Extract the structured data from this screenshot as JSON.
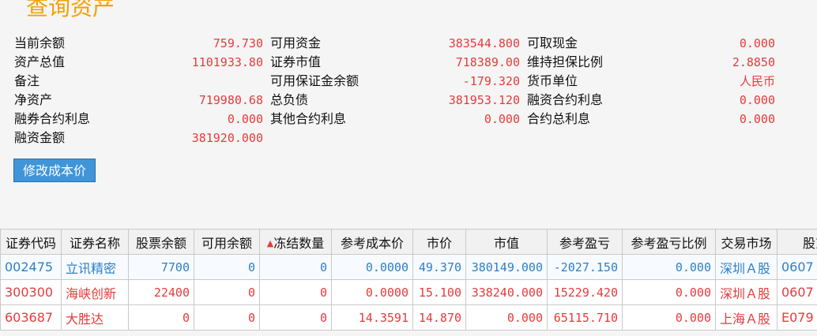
{
  "title": "查询资产",
  "summary": [
    [
      {
        "label": "当前余额",
        "value": "759.730"
      },
      {
        "label": "可用资金",
        "value": "383544.800"
      },
      {
        "label": "可取现金",
        "value": "0.000"
      }
    ],
    [
      {
        "label": "资产总值",
        "value": "1101933.80"
      },
      {
        "label": "证券市值",
        "value": "718389.00"
      },
      {
        "label": "维持担保比例",
        "value": "2.8850"
      }
    ],
    [
      {
        "label": "备注",
        "value": ""
      },
      {
        "label": "可用保证金余额",
        "value": "-179.320"
      },
      {
        "label": "货币单位",
        "value": "人民币"
      }
    ],
    [
      {
        "label": "净资产",
        "value": "719980.68"
      },
      {
        "label": "总负债",
        "value": "381953.120"
      },
      {
        "label": "融资合约利息",
        "value": "0.000"
      }
    ],
    [
      {
        "label": "融券合约利息",
        "value": "0.000"
      },
      {
        "label": "其他合约利息",
        "value": "0.000"
      },
      {
        "label": "合约总利息",
        "value": "0.000"
      }
    ],
    [
      {
        "label": "融资金额",
        "value": "381920.000"
      }
    ]
  ],
  "button": {
    "modify_cost": "修改成本价"
  },
  "table": {
    "sort_icon": "triangle-up-icon",
    "columns": [
      "证券代码",
      "证券名称",
      "股票余额",
      "可用余额",
      "冻结数量",
      "参考成本价",
      "市价",
      "市值",
      "参考盈亏",
      "参考盈亏比例",
      "交易市场",
      "股东"
    ],
    "rows": [
      [
        "002475",
        "立讯精密",
        "7700",
        "0",
        "0",
        "0.0000",
        "49.370",
        "380149.000",
        "-2027.150",
        "0.000",
        "深圳Ａ股",
        "0607"
      ],
      [
        "300300",
        "海峡创新",
        "22400",
        "0",
        "0",
        "0.0000",
        "15.100",
        "338240.000",
        "15229.420",
        "0.000",
        "深圳Ａ股",
        "0607"
      ],
      [
        "603687",
        "大胜达",
        "0",
        "0",
        "0",
        "14.3591",
        "14.870",
        "0.000",
        "65115.710",
        "0.000",
        "上海Ａ股",
        "E079"
      ]
    ]
  },
  "colors": {
    "title": "#f5a000",
    "value": "#e53b3b",
    "blue_row": "#2d7fc6",
    "button": "#3f95d8"
  }
}
